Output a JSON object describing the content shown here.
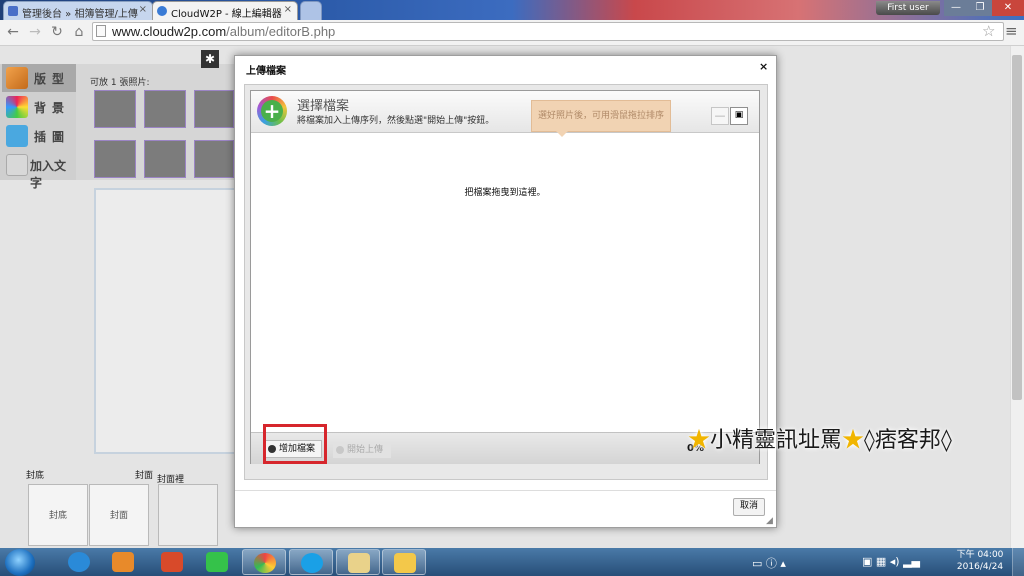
{
  "browser": {
    "tabs": [
      {
        "label": "管理後台 » 相簿管理/上傳",
        "active": false
      },
      {
        "label": "CloudW2P - 線上編輯器",
        "active": true
      }
    ],
    "user_label": "First user",
    "url_host": "www.cloudw2p.com",
    "url_path": "/album/editorB.php"
  },
  "editor": {
    "sidebar": [
      {
        "label": "版型",
        "icon": "layout-icon"
      },
      {
        "label": "背景",
        "icon": "background-icon"
      },
      {
        "label": "插圖",
        "icon": "clipart-icon"
      },
      {
        "label": "加入文字",
        "icon": "text-icon"
      }
    ],
    "thumbs_caption": "可放 1 張照片:",
    "film_labels": [
      "封底",
      "封面",
      "封面裡"
    ],
    "pages": [
      "封底",
      "封面"
    ]
  },
  "dialog": {
    "title": "上傳檔案",
    "close_glyph": "×",
    "uploader": {
      "title": "選擇檔案",
      "subtitle": "將檔案加入上傳序列，然後點選\"開始上傳\"按鈕。",
      "tooltip": "選好照片後，可用滑鼠拖拉排序",
      "drop_hint": "把檔案拖曳到這裡。",
      "add_button": "增加檔案",
      "start_button": "開始上傳",
      "progress": "0%"
    },
    "cancel_button": "取消"
  },
  "watermark": {
    "text": "小精靈訊址罵",
    "text2": "痞客邦"
  },
  "taskbar": {
    "apps": [
      "internet-explorer",
      "media-player",
      "file-share",
      "line",
      "chrome",
      "skype",
      "paint",
      "file-explorer"
    ],
    "time": "下午 04:00",
    "date": "2016/4/24"
  },
  "colors": {
    "highlight_box": "#d6262c",
    "tooltip_bg": "#f1d3b3"
  }
}
